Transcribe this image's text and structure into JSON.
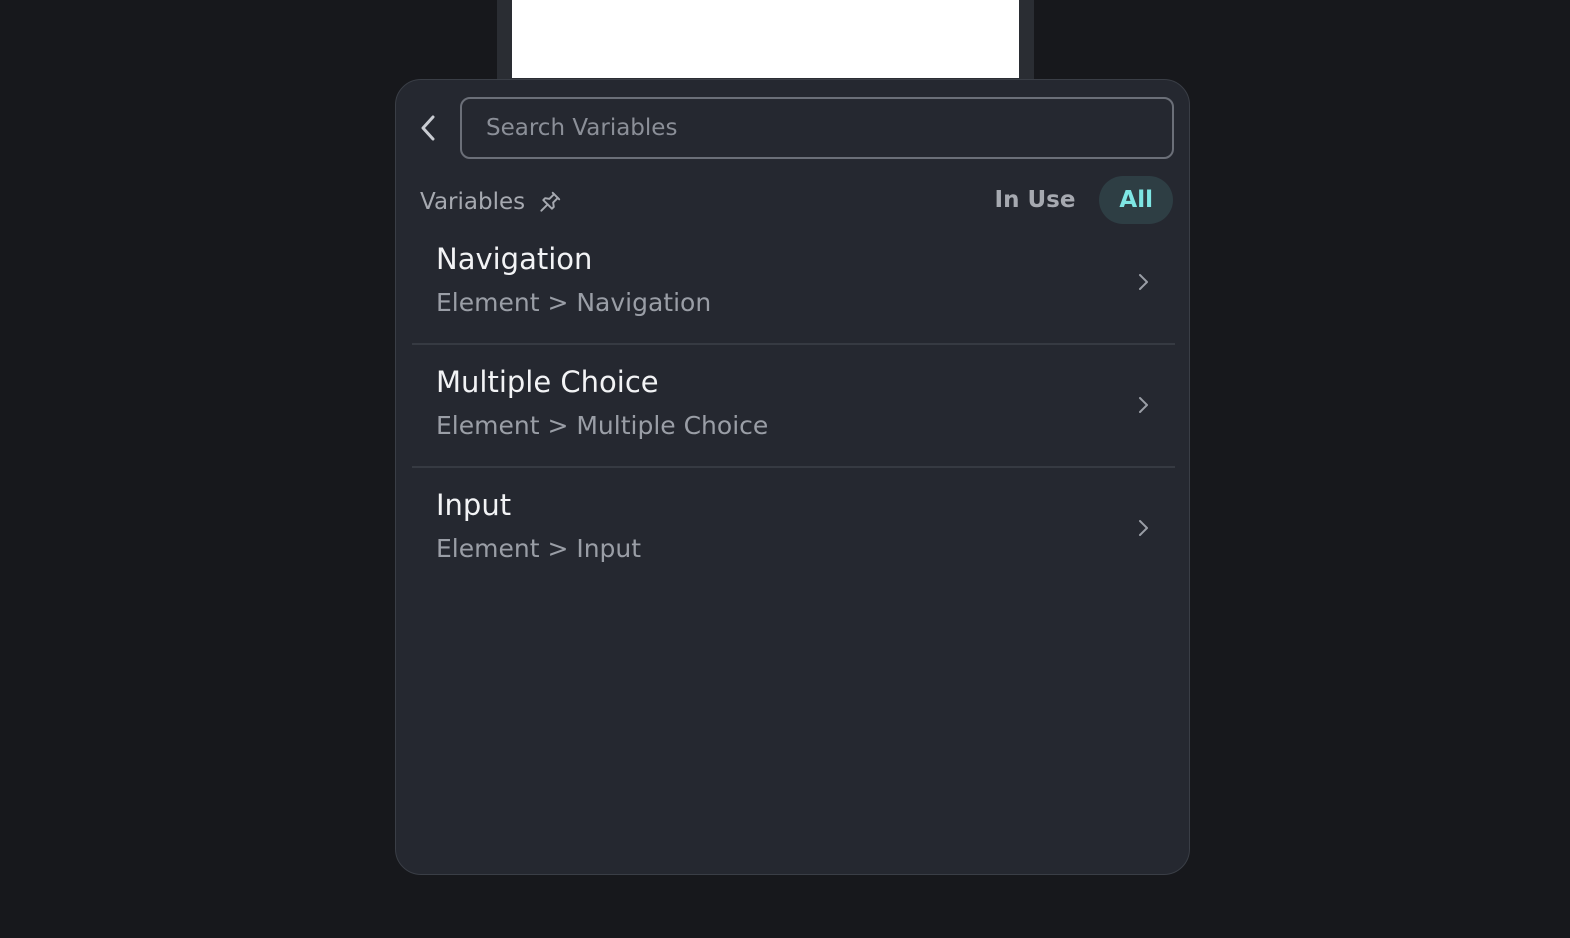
{
  "search": {
    "placeholder": "Search Variables",
    "value": ""
  },
  "header": {
    "label": "Variables",
    "filters": [
      {
        "label": "In Use",
        "active": false
      },
      {
        "label": "All",
        "active": true
      }
    ]
  },
  "variables": [
    {
      "title": "Navigation",
      "path": "Element > Navigation"
    },
    {
      "title": "Multiple Choice",
      "path": "Element > Multiple Choice"
    },
    {
      "title": "Input",
      "path": "Element > Input"
    }
  ],
  "colors": {
    "background": "#17181c",
    "panel": "#252830",
    "accent": "#7ee6e4",
    "accent_bg": "#2e3e44"
  },
  "icons": {
    "back": "chevron-left-icon",
    "pin": "pin-icon",
    "row": "chevron-right-icon"
  }
}
